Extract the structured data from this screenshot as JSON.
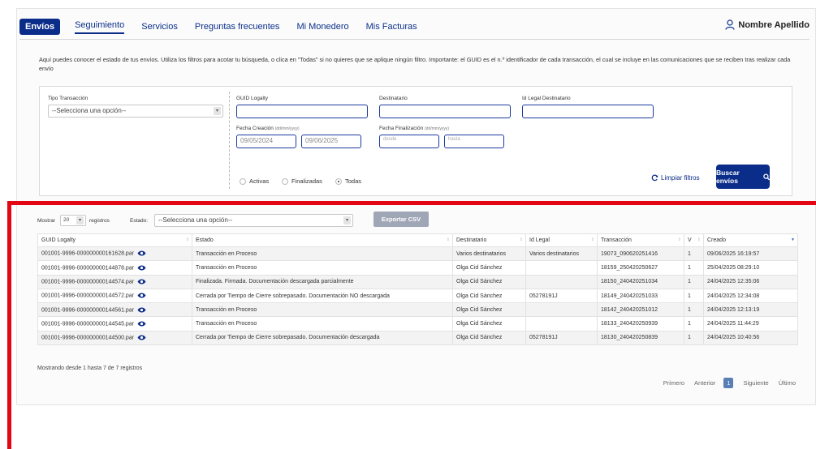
{
  "nav": {
    "tabs": [
      {
        "label": "Envíos",
        "active": true
      },
      {
        "label": "Seguimiento",
        "underline": true
      },
      {
        "label": "Servicios"
      },
      {
        "label": "Preguntas frecuentes"
      },
      {
        "label": "Mi Monedero"
      },
      {
        "label": "Mis Facturas"
      }
    ],
    "user": "Nombre Apellido"
  },
  "intro": "Aquí puedes conocer el estado de tus envíos. Utiliza los filtros para acotar tu búsqueda, o clica en \"Todas\" si no quieres que se aplique ningún filtro. Importante: el GUID es el n.º identificador de cada transacción, el cual se incluye en las comunicaciones que se reciben tras realizar cada envío",
  "filters": {
    "tipo_label": "Tipo Transacción",
    "tipo_value": "--Selecciona una opción--",
    "guid_label": "GUID Logalty",
    "dest_label": "Destinatario",
    "idlegal_label": "Id Legal Destinatario",
    "fcre_label": "Fecha Creación",
    "fcre_hint": "(dd/mm/yyyy)",
    "fcre_from": "09/05/2024",
    "fcre_to": "09/06/2025",
    "ffin_label": "Fecha Finalización",
    "ffin_hint": "(dd/mm/yyyy)",
    "ffin_from_ph": "desde",
    "ffin_to_ph": "hasta",
    "radio_activas": "Activas",
    "radio_finalizadas": "Finalizadas",
    "radio_todas": "Todas",
    "clear": "Limpiar filtros",
    "search": "Buscar envíos"
  },
  "results": {
    "mostrar": "Mostrar",
    "page_size": "20",
    "registros": "registros",
    "estado_label": "Estado:",
    "estado_value": "--Selecciona una opción--",
    "export": "Exportar CSV",
    "columns": [
      "GUID Logalty",
      "Estado",
      "Destinatario",
      "Id Legal",
      "Transacción",
      "V",
      "Creado"
    ],
    "rows": [
      [
        "001001-9996-000000000161628.par",
        "Transacción en Proceso",
        "Varios destinatarios",
        "Varios destinatarios",
        "19073_090620251416",
        "1",
        "09/06/2025 16:19:57"
      ],
      [
        "001001-9996-000000000144878.par",
        "Transacción en Proceso",
        "Olga Cid Sánchez",
        "",
        "18159_250420250627",
        "1",
        "25/04/2025 08:29:10"
      ],
      [
        "001001-9996-000000000144574.par",
        "Finalizada. Firmada. Documentación descargada parcialmente",
        "Olga Cid Sánchez",
        "",
        "18150_240420251034",
        "1",
        "24/04/2025 12:35:06"
      ],
      [
        "001001-9996-000000000144572.par",
        "Cerrada por Tiempo de Cierre sobrepasado. Documentación NO descargada",
        "Olga Cid Sánchez",
        "05278191J",
        "18149_240420251033",
        "1",
        "24/04/2025 12:34:08"
      ],
      [
        "001001-9996-000000000144561.par",
        "Transacción en Proceso",
        "Olga Cid Sánchez",
        "",
        "18142_240420251012",
        "1",
        "24/04/2025 12:13:19"
      ],
      [
        "001001-9996-000000000144545.par",
        "Transacción en Proceso",
        "Olga Cid Sánchez",
        "",
        "18133_240420250939",
        "1",
        "24/04/2025 11:44:29"
      ],
      [
        "001001-9996-000000000144500.par",
        "Cerrada por Tiempo de Cierre sobrepasado. Documentación descargada",
        "Olga Cid Sánchez",
        "05278191J",
        "18130_240420250839",
        "1",
        "24/04/2025 10:40:56"
      ]
    ],
    "info": "Mostrando desde 1 hasta 7 de 7 registros",
    "pager": {
      "first": "Primero",
      "prev": "Anterior",
      "current": "1",
      "next": "Siguiente",
      "last": "Último"
    }
  },
  "colors": {
    "brand": "#0b2d8a",
    "annotation": "#e30613"
  }
}
